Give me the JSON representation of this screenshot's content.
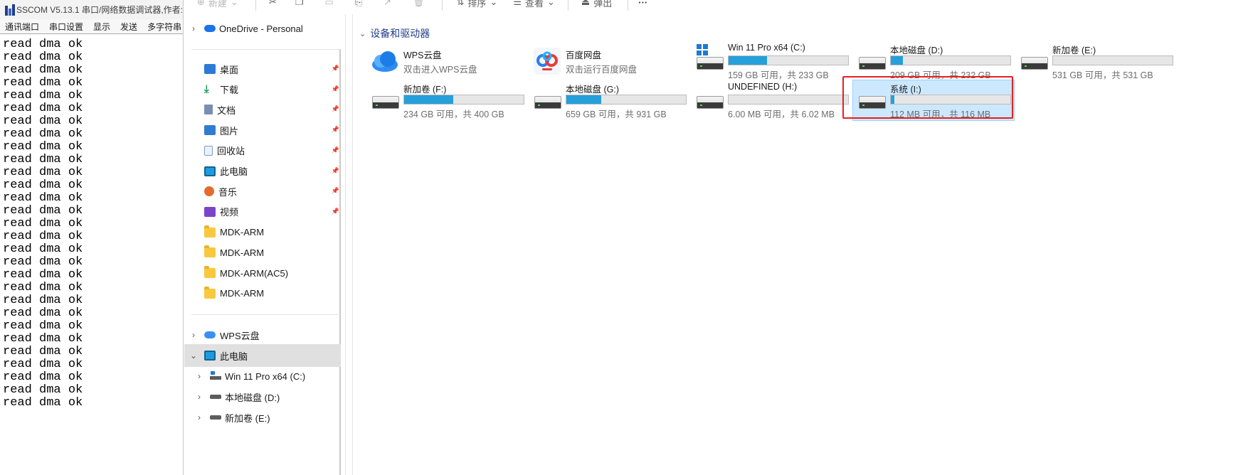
{
  "sscom": {
    "title": "SSCOM V5.13.1 串口/网络数据调试器,作者:",
    "menu": [
      "通讯端口",
      "串口设置",
      "显示",
      "发送",
      "多字符串"
    ],
    "lines": [
      "read dma ok",
      "read dma ok",
      "read dma ok",
      "read dma ok",
      "read dma ok",
      "read dma ok",
      "read dma ok",
      "read dma ok",
      "read dma ok",
      "read dma ok",
      "read dma ok",
      "read dma ok",
      "read dma ok",
      "read dma ok",
      "read dma ok",
      "read dma ok",
      "read dma ok",
      "read dma ok",
      "read dma ok",
      "read dma ok",
      "read dma ok",
      "read dma ok",
      "read dma ok",
      "read dma ok",
      "read dma ok",
      "read dma ok",
      "read dma ok",
      "read dma ok",
      "read dma ok"
    ]
  },
  "toolbar": {
    "new_label": "新建",
    "sort_label": "排序",
    "view_label": "查看",
    "eject_label": "弹出",
    "more_label": "···"
  },
  "nav": {
    "onedrive": "OneDrive - Personal",
    "quick": [
      {
        "label": "桌面",
        "icon": "desktop-icon"
      },
      {
        "label": "下载",
        "icon": "download-icon"
      },
      {
        "label": "文档",
        "icon": "document-icon"
      },
      {
        "label": "图片",
        "icon": "pictures-icon"
      },
      {
        "label": "回收站",
        "icon": "recycle-bin-icon"
      },
      {
        "label": "此电脑",
        "icon": "this-pc-icon"
      },
      {
        "label": "音乐",
        "icon": "music-icon"
      },
      {
        "label": "视频",
        "icon": "video-icon"
      },
      {
        "label": "MDK-ARM",
        "icon": "folder-icon"
      },
      {
        "label": "MDK-ARM",
        "icon": "folder-icon"
      },
      {
        "label": "MDK-ARM(AC5)",
        "icon": "folder-icon"
      },
      {
        "label": "MDK-ARM",
        "icon": "folder-icon"
      }
    ],
    "wps": "WPS云盘",
    "this_pc": "此电脑",
    "drives": [
      "Win 11 Pro x64 (C:)",
      "本地磁盘 (D:)",
      "新加卷 (E:)"
    ]
  },
  "content": {
    "section_title": "设备和驱动器",
    "apps": [
      {
        "name": "WPS云盘",
        "sub": "双击进入WPS云盘"
      },
      {
        "name": "百度网盘",
        "sub": "双击运行百度网盘"
      }
    ],
    "drives": [
      {
        "name": "Win 11 Pro x64 (C:)",
        "free": "159 GB 可用，共 233 GB",
        "used_fraction": 0.32
      },
      {
        "name": "本地磁盘 (D:)",
        "free": "209 GB 可用，共 232 GB",
        "used_fraction": 0.1
      },
      {
        "name": "新加卷 (E:)",
        "free": "531 GB 可用，共 531 GB",
        "used_fraction": 0.0
      },
      {
        "name": "新加卷 (F:)",
        "free": "234 GB 可用，共 400 GB",
        "used_fraction": 0.41
      },
      {
        "name": "本地磁盘 (G:)",
        "free": "659 GB 可用，共 931 GB",
        "used_fraction": 0.29
      },
      {
        "name": "UNDEFINED (H:)",
        "free": "6.00 MB 可用，共 6.02 MB",
        "used_fraction": 0.0
      },
      {
        "name": "系统 (I:)",
        "free": "112 MB 可用，共 116 MB",
        "used_fraction": 0.03
      }
    ]
  },
  "colors": {
    "accent": "#26a0da",
    "highlight": "#e62020",
    "selection": "#cce8ff"
  }
}
